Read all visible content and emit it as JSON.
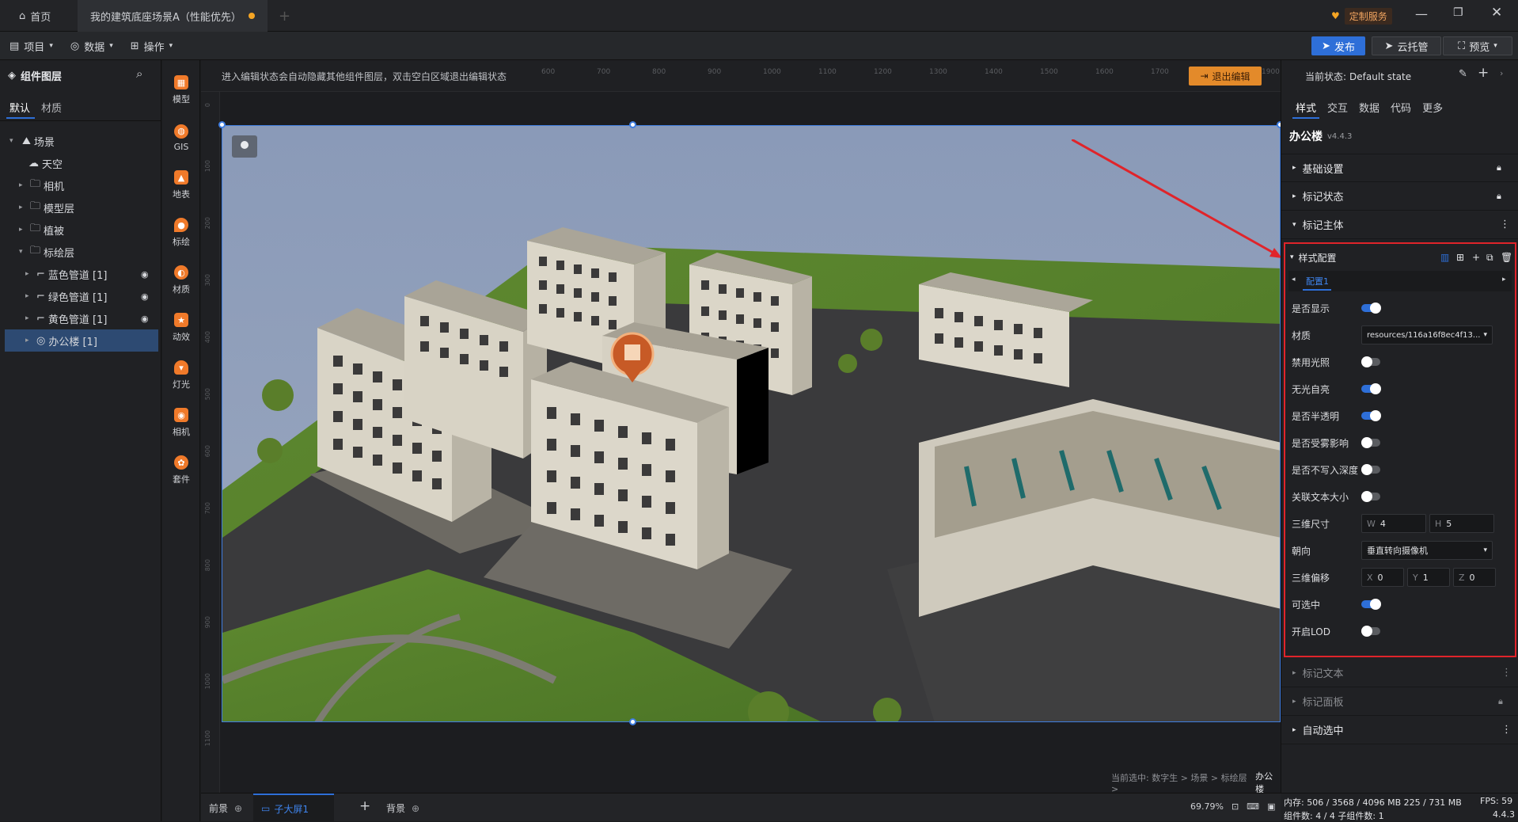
{
  "titlebar": {
    "home_tab": "首页",
    "project_tab": "我的建筑底座场景A（性能优先）",
    "custom_service": "定制服务"
  },
  "menubar": {
    "items": [
      "项目",
      "数据",
      "操作"
    ],
    "publish": "发布",
    "cloud": "云托管",
    "preview": "预览"
  },
  "leftpanel": {
    "title": "组件图层",
    "tabs": [
      "默认",
      "材质"
    ],
    "tree": [
      {
        "label": "场景",
        "icon": "scene-icon"
      },
      {
        "label": "天空",
        "icon": "sky-icon"
      },
      {
        "label": "相机",
        "icon": "folder-icon"
      },
      {
        "label": "模型层",
        "icon": "folder-icon"
      },
      {
        "label": "植被",
        "icon": "folder-icon"
      },
      {
        "label": "标绘层",
        "icon": "folder-icon"
      },
      {
        "label": "蓝色管道 [1]",
        "icon": "pipe-icon"
      },
      {
        "label": "绿色管道 [1]",
        "icon": "pipe-icon"
      },
      {
        "label": "黄色管道 [1]",
        "icon": "pipe-icon"
      },
      {
        "label": "办公楼 [1]",
        "icon": "marker-icon"
      }
    ]
  },
  "toolcol": {
    "tools": [
      "模型",
      "GIS",
      "地表",
      "标绘",
      "材质",
      "动效",
      "灯光",
      "相机",
      "套件"
    ]
  },
  "canvas": {
    "hint": "进入编辑状态会自动隐藏其他组件图层，双击空白区域退出编辑状态",
    "exit_edit": "退出编辑",
    "ruler_top": [
      "600",
      "700",
      "800",
      "900",
      "1000",
      "1100",
      "1200",
      "1300",
      "1400",
      "1500",
      "1600",
      "1700",
      "1800",
      "1900"
    ],
    "ruler_left": [
      "0",
      "100",
      "200",
      "300",
      "400",
      "500",
      "600",
      "700",
      "800",
      "900",
      "1000",
      "1100"
    ],
    "breadcrumb_prefix": "当前选中: 数字生 > 场景 > 标绘层 >",
    "breadcrumb_current": "办公楼"
  },
  "rightpanel": {
    "state_label": "当前状态: ",
    "state_value": "Default state",
    "tabs": [
      "样式",
      "交互",
      "数据",
      "代码",
      "更多"
    ],
    "component_name": "办公楼",
    "component_version": "v4.4.3",
    "sections": {
      "basic": "基础设置",
      "marker_state": "标记状态",
      "marker_body": "标记主体",
      "style_config": "样式配置",
      "marker_text": "标记文本",
      "marker_panel": "标记面板",
      "auto_select": "自动选中"
    },
    "config_tab": "配置1",
    "props": {
      "visible": "是否显示",
      "material": "材质",
      "material_value": "resources/116a16f8ec4f13...",
      "disable_light": "禁用光照",
      "unlit": "无光自亮",
      "translucent": "是否半透明",
      "fog": "是否受雾影响",
      "no_depth": "是否不写入深度",
      "link_text_size": "关联文本大小",
      "size3d": "三维尺寸",
      "w_label": "W",
      "w_value": "4",
      "h_label": "H",
      "h_value": "5",
      "orientation": "朝向",
      "orientation_value": "垂直转向摄像机",
      "offset3d": "三维偏移",
      "x_label": "X",
      "x_value": "0",
      "y_label": "Y",
      "y_value": "1",
      "z_label": "Z",
      "z_value": "0",
      "selectable": "可选中",
      "lod": "开启LOD"
    }
  },
  "bottombar": {
    "foreground": "前景",
    "child_screen": "子大屏1",
    "background": "背景",
    "zoom": "69.79%"
  },
  "statusbar": {
    "memory": "内存:  506 / 3568 / 4096 MB  225 / 731 MB",
    "fps": "FPS:  59",
    "components": "组件数: 4 / 4   子组件数: 1",
    "version": "4.4.3"
  },
  "colors": {
    "accent": "#2e6fd8",
    "orange": "#f07a2a",
    "annotation_red": "#e0242a"
  }
}
